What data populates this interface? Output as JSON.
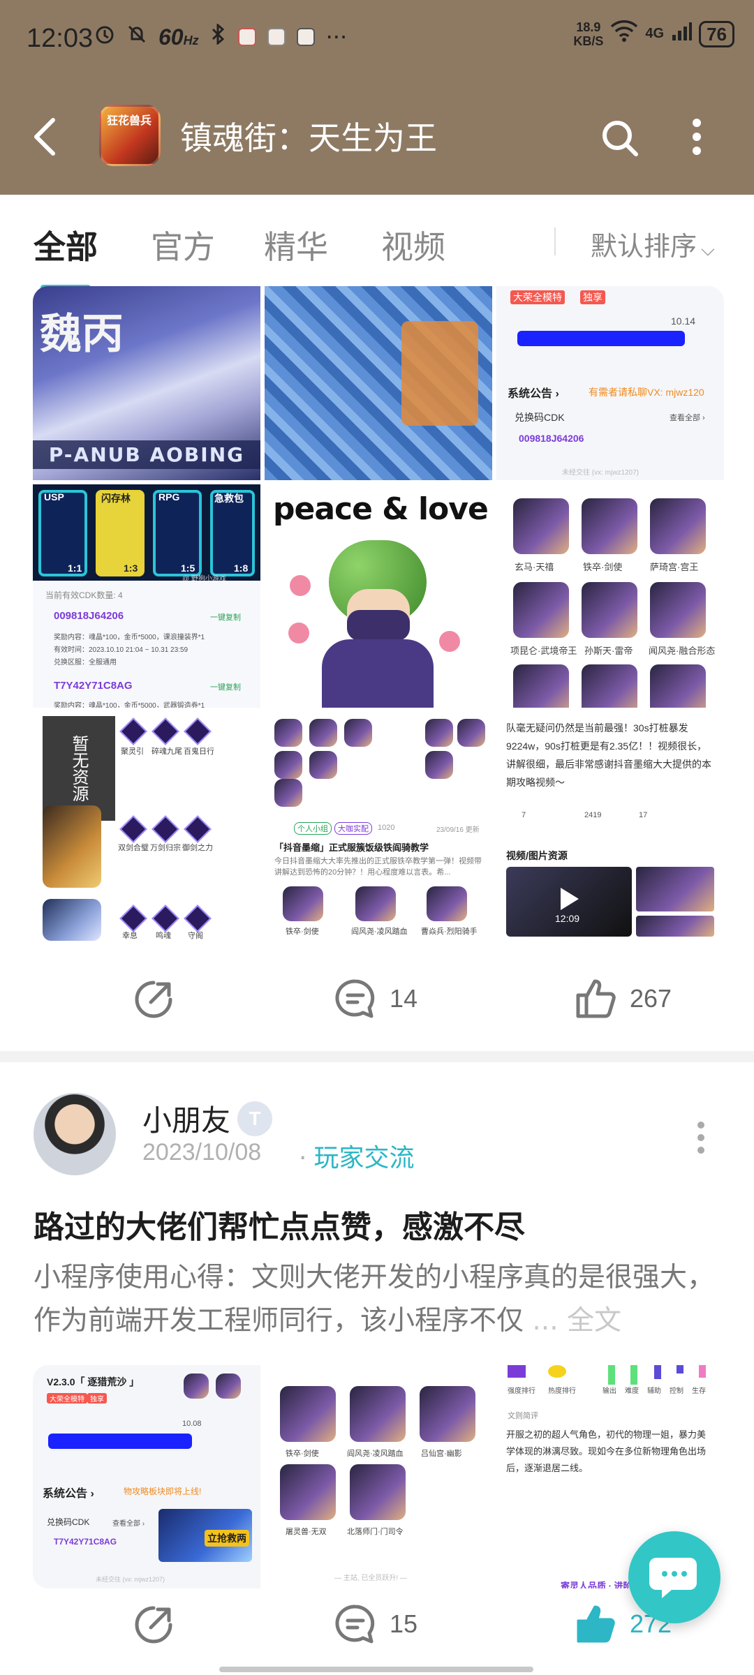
{
  "status": {
    "time": "12:03",
    "hz": "60",
    "hz_unit": "Hz",
    "ellipsis": "···",
    "speed": "18.9",
    "speed_unit": "KB/S",
    "network": "4G",
    "battery": "76"
  },
  "header": {
    "app_icon_text": "狂花兽兵",
    "title": "镇魂街：天生为王"
  },
  "tabs": [
    {
      "label": "全部"
    },
    {
      "label": "官方"
    },
    {
      "label": "精华"
    },
    {
      "label": "视频"
    }
  ],
  "sort_label": "默认排序",
  "post1": {
    "grid": {
      "armor_caption": "P-ANUB AOBING",
      "armor_title": "魏丙",
      "panel_tag1": "大荣全模特",
      "panel_tag2": "独享",
      "panel_value": "10.14",
      "announce_label": "系统公告 ›",
      "announce_note": "有需者请私聊VX: mjwz120",
      "cdk_label": "兑换码CDK",
      "cdk_view_all": "查看全部 ›",
      "cdk_code": "009818J64206",
      "footer_note": "未经交往 (vx: mjwz1207)",
      "cdk_count": "当前有效CDK数量: 4",
      "cdk_code_1": "009818J64206",
      "cdk_copy_1": "一键复制",
      "cdk_reward_1": "奖励内容：魂晶*100，金币*5000，课浪撞装界*1",
      "cdk_valid_1": "有效时间：2023.10.10 21:04 ~ 10.31 23:59",
      "cdk_range_1": "兑换区服：全服通用",
      "cdk_code_2": "T7Y42Y71C8AG",
      "cdk_copy_2": "一键复制",
      "cdk_reward_2": "奖励内容：魂晶*100，金币*5000，武器锻造券*1",
      "weapon_labels": [
        "USP",
        "闪存林",
        "RPG",
        "急救包"
      ],
      "weapon_counts": [
        "1:1",
        "1:3",
        "1:5",
        "1:8"
      ],
      "weapon_watermark": "@ 野狗小游戏",
      "love_text": "peace & love",
      "char_names": [
        "玄马·天禧",
        "铁卒·剑使",
        "萨琦宫·宫王",
        "项昆仑·武境帝王",
        "孙斯天·雷帝",
        "闻风尧·融合形态"
      ],
      "no_resource": "暂无资源",
      "skill_row1": [
        "聚灵引",
        "碎魂九尾",
        "百鬼日行"
      ],
      "skill_row2": [
        "双剑合璧",
        "万剑归宗",
        "御剑之力"
      ],
      "skill_row3": [
        "幸息",
        "鸣魂",
        "守阁"
      ],
      "article_tags": [
        "个人小组",
        "大咖实配"
      ],
      "article_count": "1020",
      "article_date": "23/09/16 更新",
      "article_title": "「抖音墨缩」正式服簇饭级铁阎骑教学",
      "article_body": "今日抖音墨缩大大率先推出的正式服铁卒教学第一弹！视频带讲解达到恐怖的20分钟？！用心程度难以言表。希...",
      "article_chars": [
        "铁卒·剑使",
        "阎风尧·凌风踏血",
        "曹焱兵·烈阳骑手"
      ],
      "text_para": "队毫无疑问仍然是当前最强！30s打桩暴发9224w，90s打桩更是有2.35亿！！视频很长，讲解很细，最后非常感谢抖音墨缩大大提供的本期攻略视频～",
      "text_stats": [
        "7",
        "2419",
        "17"
      ],
      "video_section": "视频/图片资源",
      "video_duration": "12:09"
    },
    "share_label": "",
    "comments": "14",
    "likes": "267"
  },
  "post2": {
    "username": "小朋友",
    "level": "T",
    "date": "2023/10/08",
    "dot": "·",
    "category": "玩家交流",
    "title": "路过的大佬们帮忙点点赞，感激不尽",
    "body": "小程序使用心得：文则大佬开发的小程序真的是很强大，作为前端开发工程师同行，该小程序不仅",
    "more": " ... 全文",
    "grid": {
      "panel_version": "V2.3.0「 逐猎荒沙 」",
      "panel_tag1": "大荣全模特",
      "panel_tag2": "独享",
      "panel_value": "10.08",
      "announce_label": "系统公告 ›",
      "announce_note": "物攻略板块即将上线!",
      "cdk_label": "兑换码CDK",
      "cdk_view_all": "查看全部 ›",
      "cdk_code": "T7Y42Y71C8AG",
      "promo": "立抢救两",
      "footer_note": "未经交往 (vx: mjwz1207)",
      "char_names": [
        "铁卒·剑使",
        "阎风尧·凌风踏血",
        "吕仙宫·幽影",
        "屠灵兽·无双",
        "北落师门·门司令"
      ],
      "char_footer": "— 主站, 已全员跃升! —",
      "rank_labels": [
        "强度排行",
        "热度排行"
      ],
      "stat_labels": [
        "输出",
        "难度",
        "辅助",
        "控制",
        "生存"
      ],
      "intro_label": "文则简评",
      "intro_text": "开服之初的超人气角色，初代的物理一姐，暴力美学体现的淋漓尽致。现如今在多位新物理角色出场后，逐渐退居二线。",
      "footer_link": "寄灵人品质 · 进阶"
    },
    "comments": "15",
    "likes": "272"
  },
  "colors": {
    "header_bg": "#8e7a63",
    "accent": "#2cb6c6",
    "tab_active": "#222222",
    "tab_inactive": "#888888"
  }
}
